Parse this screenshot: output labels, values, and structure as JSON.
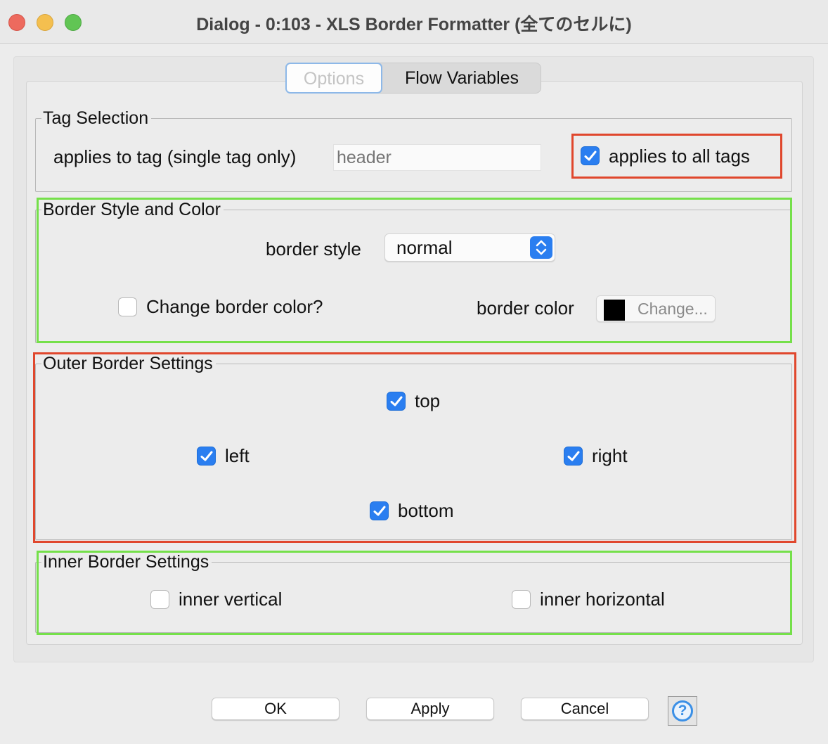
{
  "window": {
    "title": "Dialog - 0:103 - XLS Border Formatter (全てのセルに)"
  },
  "tabs": [
    {
      "label": "Options",
      "selected": true
    },
    {
      "label": "Flow Variables",
      "selected": false
    }
  ],
  "tag_selection": {
    "legend": "Tag Selection",
    "tag_label": "applies to tag (single tag only)",
    "tag_value": "header",
    "all_tags_label": "applies to all tags",
    "all_tags_checked": true
  },
  "border_style": {
    "legend": "Border Style and Color",
    "style_label": "border style",
    "style_value": "normal",
    "change_color_label": "Change border color?",
    "change_color_checked": false,
    "color_label": "border color",
    "color_value": "#000000",
    "change_button_label": "Change..."
  },
  "outer_border": {
    "legend": "Outer Border Settings",
    "top_label": "top",
    "left_label": "left",
    "right_label": "right",
    "bottom_label": "bottom",
    "top_checked": true,
    "left_checked": true,
    "right_checked": true,
    "bottom_checked": true
  },
  "inner_border": {
    "legend": "Inner Border Settings",
    "vertical_label": "inner vertical",
    "horizontal_label": "inner horizontal",
    "vertical_checked": false,
    "horizontal_checked": false
  },
  "buttons": {
    "ok": "OK",
    "apply": "Apply",
    "cancel": "Cancel",
    "help": "?"
  },
  "colors": {
    "highlight_red": "#e0472d",
    "highlight_green": "#75e04a",
    "checkbox_blue": "#2a7ef0"
  }
}
